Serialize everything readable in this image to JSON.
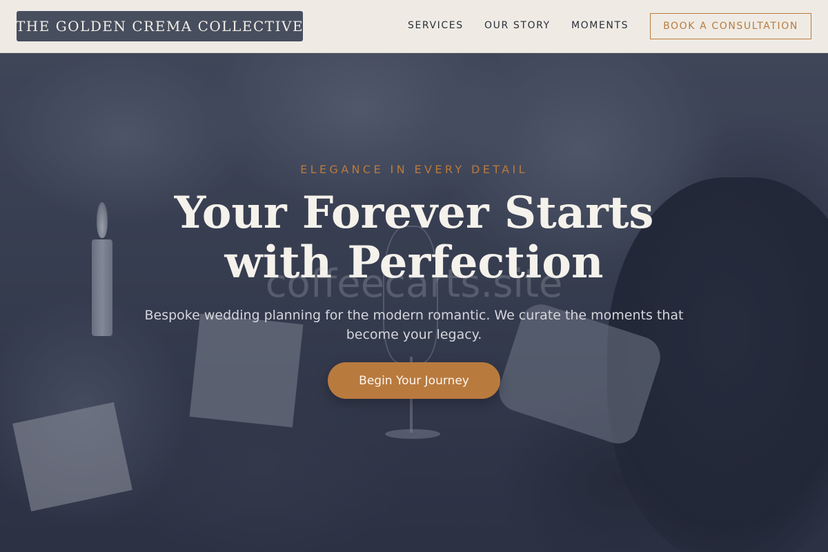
{
  "header": {
    "logo": "THE GOLDEN CREMA COLLECTIVE",
    "nav": [
      {
        "label": "SERVICES"
      },
      {
        "label": "OUR STORY"
      },
      {
        "label": "MOMENTS"
      }
    ],
    "cta_label": "BOOK A CONSULTATION"
  },
  "hero": {
    "eyebrow": "ELEGANCE IN EVERY DETAIL",
    "title": "Your Forever Starts with Perfection",
    "watermark": "coffeecarts.site",
    "subtitle": "Bespoke wedding planning for the modern romantic. We curate the moments that become your legacy.",
    "cta_label": "Begin Your Journey"
  },
  "colors": {
    "accent": "#b97a3e",
    "header_bg": "#efebe4",
    "logo_bg": "#474e5e",
    "hero_overlay": "#2e3446"
  }
}
